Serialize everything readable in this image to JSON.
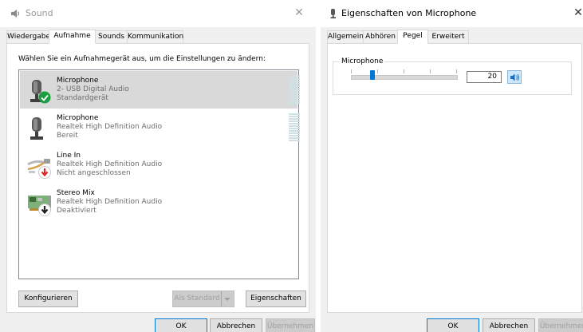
{
  "sound_dialog": {
    "title": "Sound",
    "tabs": [
      "Wiedergabe",
      "Aufnahme",
      "Sounds",
      "Kommunikation"
    ],
    "active_tab": "Aufnahme",
    "prompt": "Wählen Sie ein Aufnahmegerät aus, um die Einstellungen zu ändern:",
    "devices": [
      {
        "name": "Microphone",
        "driver": "2- USB Digital Audio",
        "status": "Standardgerät",
        "icon": "microphone-icon",
        "badge": "check",
        "selected": true,
        "meter": true
      },
      {
        "name": "Microphone",
        "driver": "Realtek High Definition Audio",
        "status": "Bereit",
        "icon": "microphone-icon",
        "badge": "none",
        "selected": false,
        "meter": true
      },
      {
        "name": "Line In",
        "driver": "Realtek High Definition Audio",
        "status": "Nicht angeschlossen",
        "icon": "line-in-cable-icon",
        "badge": "red-down-arrow",
        "selected": false,
        "meter": false
      },
      {
        "name": "Stereo Mix",
        "driver": "Realtek High Definition Audio",
        "status": "Deaktiviert",
        "icon": "sound-card-icon",
        "badge": "black-down-arrow",
        "selected": false,
        "meter": false
      }
    ],
    "buttons": {
      "configure": "Konfigurieren",
      "set_default": "Als Standard",
      "properties": "Eigenschaften",
      "ok": "OK",
      "cancel": "Abbrechen",
      "apply": "Übernehmen"
    }
  },
  "props_dialog": {
    "title": "Eigenschaften von Microphone",
    "tabs": [
      "Allgemein",
      "Abhören",
      "Pegel",
      "Erweitert"
    ],
    "active_tab": "Pegel",
    "level_group_label": "Microphone",
    "level_value": "20",
    "level_fraction": 0.2,
    "buttons": {
      "ok": "OK",
      "cancel": "Abbrechen",
      "apply": "Übernehmen"
    }
  },
  "colors": {
    "accent": "#0078d7",
    "selected_row": "#d9d9d9",
    "check_badge": "#1a9e3f",
    "red_badge": "#e0282a"
  }
}
